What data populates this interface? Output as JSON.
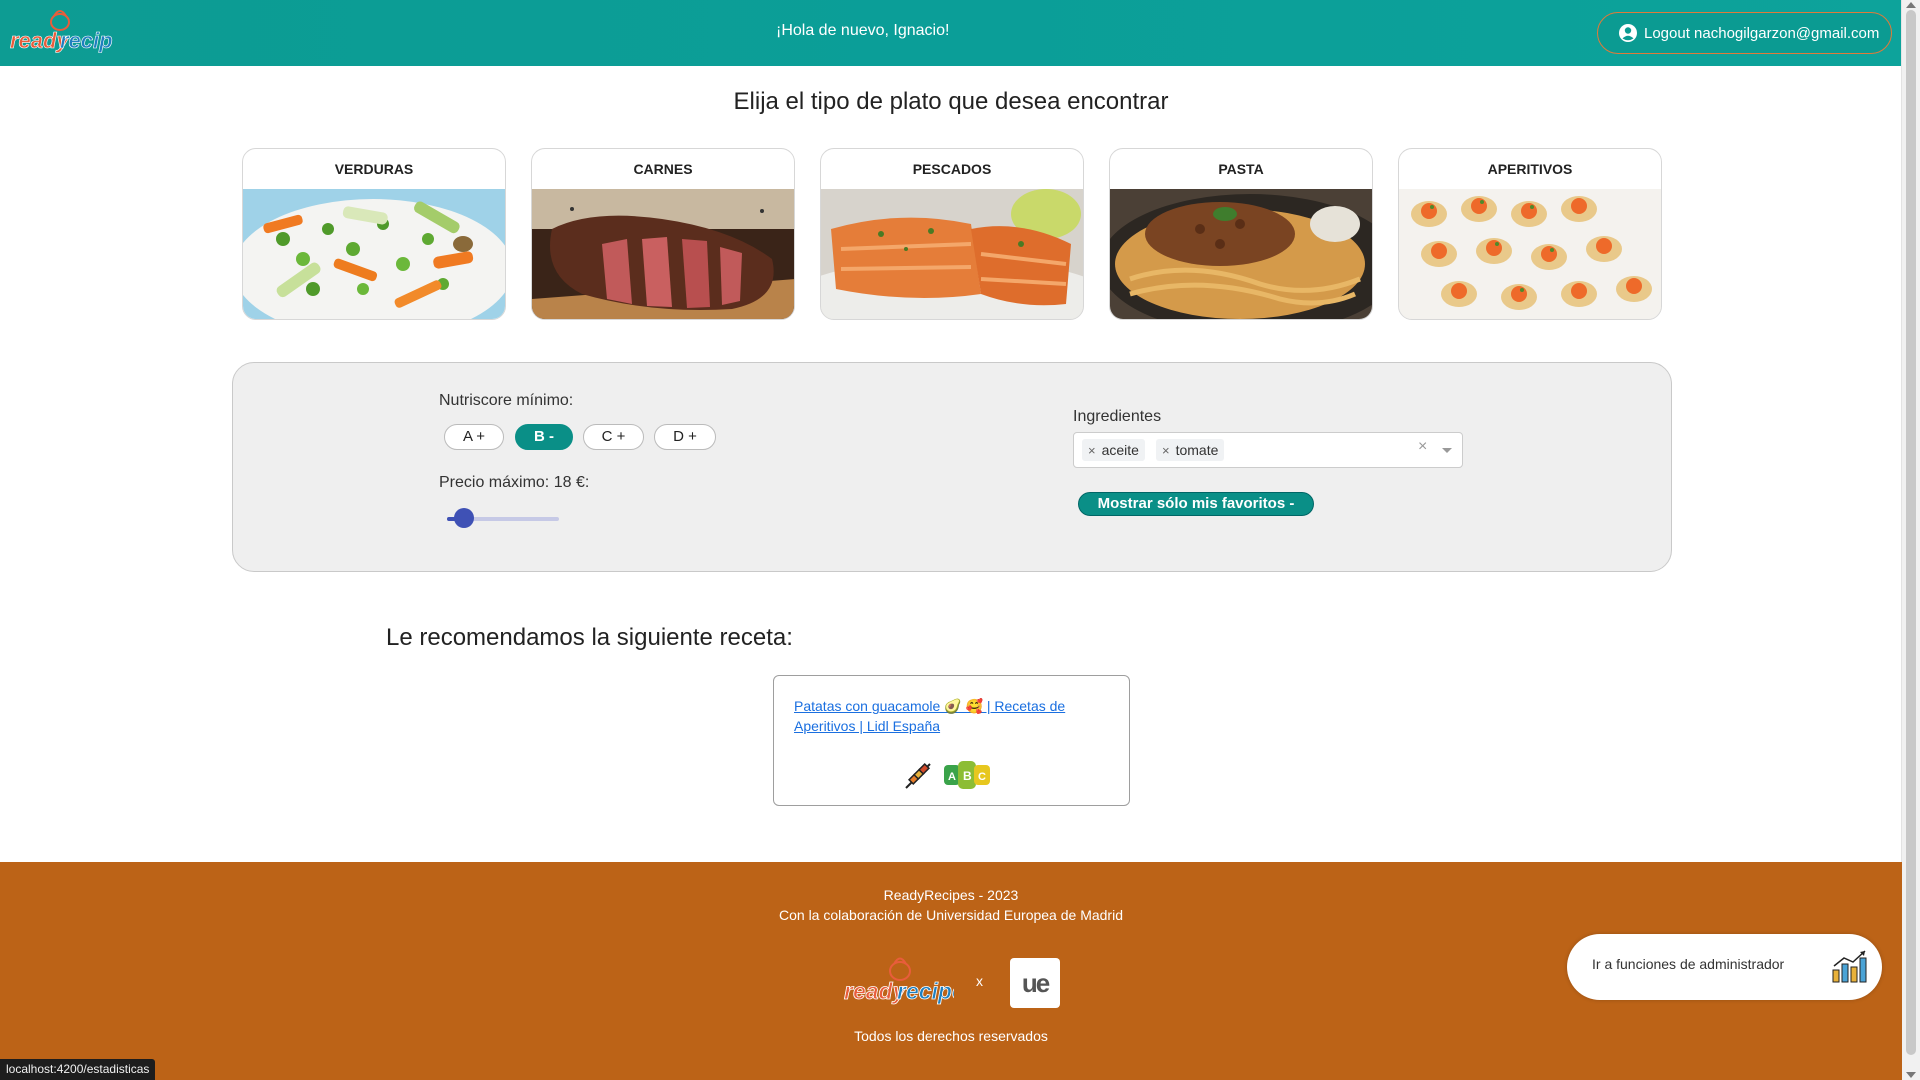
{
  "header": {
    "brand": "readyrecipes",
    "greeting": "¡Hola de nuevo, Ignacio!",
    "logout_label": "Logout nachogilgarzon@gmail.com"
  },
  "main": {
    "section_title": "Elija el tipo de plato que desea encontrar",
    "categories": [
      {
        "label": "VERDURAS"
      },
      {
        "label": "CARNES"
      },
      {
        "label": "PESCADOS"
      },
      {
        "label": "PASTA"
      },
      {
        "label": "APERITIVOS"
      }
    ],
    "filters": {
      "nutriscore_label": "Nutriscore mínimo:",
      "nutriscore_options": [
        {
          "label": "A  +",
          "selected": false
        },
        {
          "label": "B  -",
          "selected": true
        },
        {
          "label": "C  +",
          "selected": false
        },
        {
          "label": "D  +",
          "selected": false
        }
      ],
      "price_label": "Precio máximo: 18 €:",
      "price_slider_value_fraction": 0.15,
      "ingredients_label": "Ingredientes",
      "ingredients": [
        "aceite",
        "tomate"
      ],
      "favorites_button": "Mostrar sólo mis favoritos  -"
    },
    "recommendation": {
      "title": "Le recomendamos la siguiente receta:",
      "link_text": "Patatas con guacamole 🥑 🥰 | Recetas de Aperitivos | Lidl España",
      "nutriscore_badge": "ABC"
    }
  },
  "footer": {
    "line1": "ReadyRecipes - 2023",
    "line2": "Con la colaboración de Universidad Europea de Madrid",
    "separator": "x",
    "partner_logo": "ue",
    "rights": "Todos los derechos reservados",
    "admin_button": "Ir a funciones de administrador"
  },
  "status_bar": {
    "url": "localhost:4200/estadisticas"
  },
  "colors": {
    "header": "#0d9c93",
    "accent": "#0a8f87",
    "footer": "#bc6317",
    "slider": "#3f51b5",
    "link": "#1a6fe0"
  },
  "icons": {
    "user": "account-circle-icon",
    "recipe": "skewer-icon",
    "admin": "bar-chart-icon"
  }
}
